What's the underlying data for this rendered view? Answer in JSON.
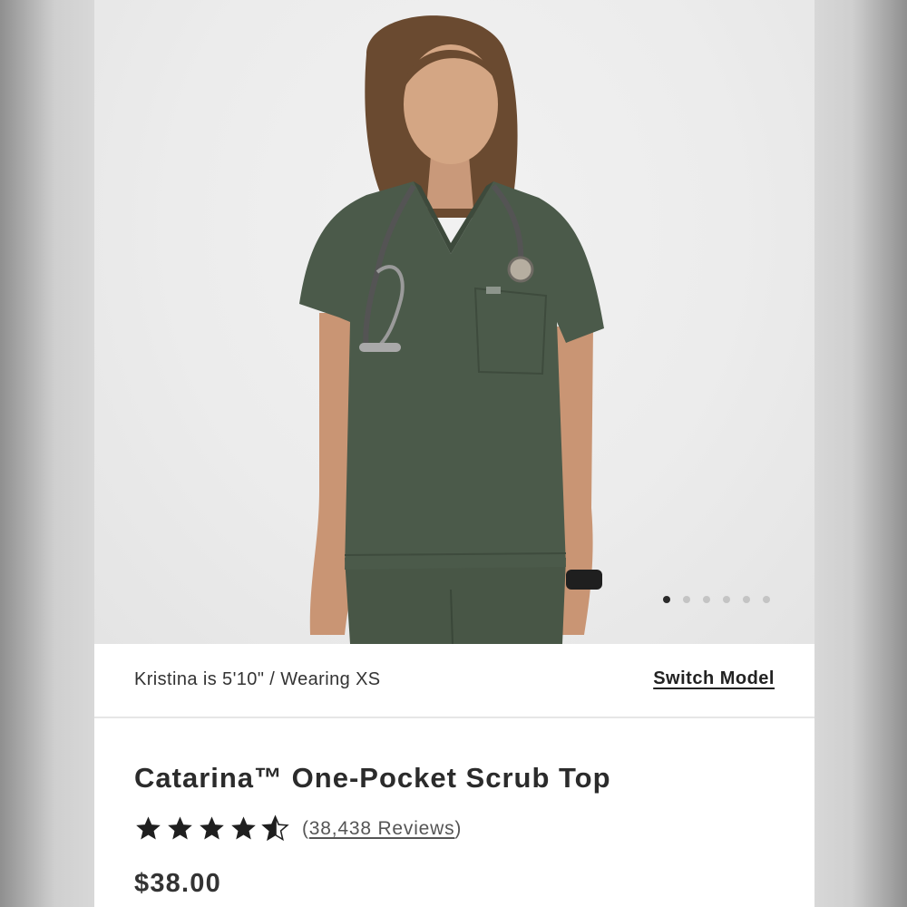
{
  "gallery": {
    "image_alt": "Model wearing olive green scrub top with stethoscope",
    "slide_count": 6,
    "active_slide": 1
  },
  "model": {
    "info": "Kristina is 5'10\" / Wearing XS",
    "switch_label": "Switch Model"
  },
  "product": {
    "title": "Catarina™ One-Pocket Scrub Top",
    "rating": 4.5,
    "rating_max": 5,
    "reviews_open": "(",
    "reviews_text": "38,438 Reviews",
    "reviews_close": ")",
    "price": "$38.00",
    "color": "#4b5a4a"
  }
}
